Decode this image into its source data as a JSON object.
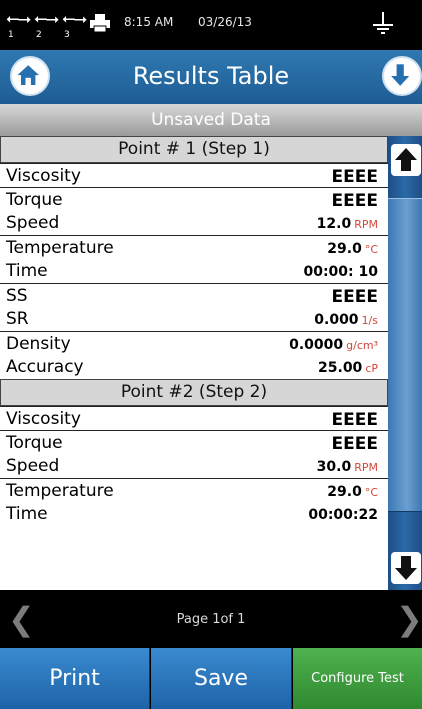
{
  "status_bar": {
    "usb_ports": [
      {
        "icon": "usb-icon",
        "number": "1"
      },
      {
        "icon": "usb-icon",
        "number": "2"
      },
      {
        "icon": "usb-icon",
        "number": "3"
      }
    ],
    "printer_icon": "printer-icon",
    "time": "8:15 AM",
    "date": "03/26/13",
    "ground_icon": "ground-icon"
  },
  "header": {
    "title": "Results Table",
    "home_icon": "home-icon",
    "down_icon": "arrow-down-icon"
  },
  "banner": "Unsaved Data",
  "points": [
    {
      "title": "Point # 1 (Step  1)",
      "rows": [
        {
          "label": "Viscosity",
          "value": "EEEE",
          "unit": ""
        },
        {
          "label": "Torque",
          "value": "EEEE",
          "unit": ""
        },
        {
          "label": "Speed",
          "value": "12.0",
          "unit": "RPM"
        },
        {
          "label": "Temperature",
          "value": "29.0",
          "unit": "°C"
        },
        {
          "label": "Time",
          "value": "00:00: 10",
          "unit": ""
        },
        {
          "label": "SS",
          "value": "EEEE",
          "unit": ""
        },
        {
          "label": "SR",
          "value": "0.000",
          "unit": "1/s"
        },
        {
          "label": "Density",
          "value": "0.0000",
          "unit": "g/cm³"
        },
        {
          "label": "Accuracy",
          "value": "25.00",
          "unit": "cP"
        }
      ]
    },
    {
      "title": "Point #2 (Step 2)",
      "rows": [
        {
          "label": "Viscosity",
          "value": "EEEE",
          "unit": ""
        },
        {
          "label": "Torque",
          "value": "EEEE",
          "unit": ""
        },
        {
          "label": "Speed",
          "value": "30.0",
          "unit": "RPM"
        },
        {
          "label": "Temperature",
          "value": "29.0",
          "unit": "°C"
        },
        {
          "label": "Time",
          "value": "00:00:22",
          "unit": ""
        }
      ]
    }
  ],
  "scroll": {
    "up_icon": "arrow-up-icon",
    "down_icon": "arrow-down-icon"
  },
  "pager": {
    "label": "Page 1of 1",
    "prev": "❮",
    "next": "❯"
  },
  "buttons": {
    "print": "Print",
    "save": "Save",
    "configure": "Configure Test"
  },
  "colors": {
    "accent_blue": "#2670b0",
    "green": "#3a9c3a",
    "unit_red": "#d0473a",
    "header_gray": "#d6d6d6"
  }
}
